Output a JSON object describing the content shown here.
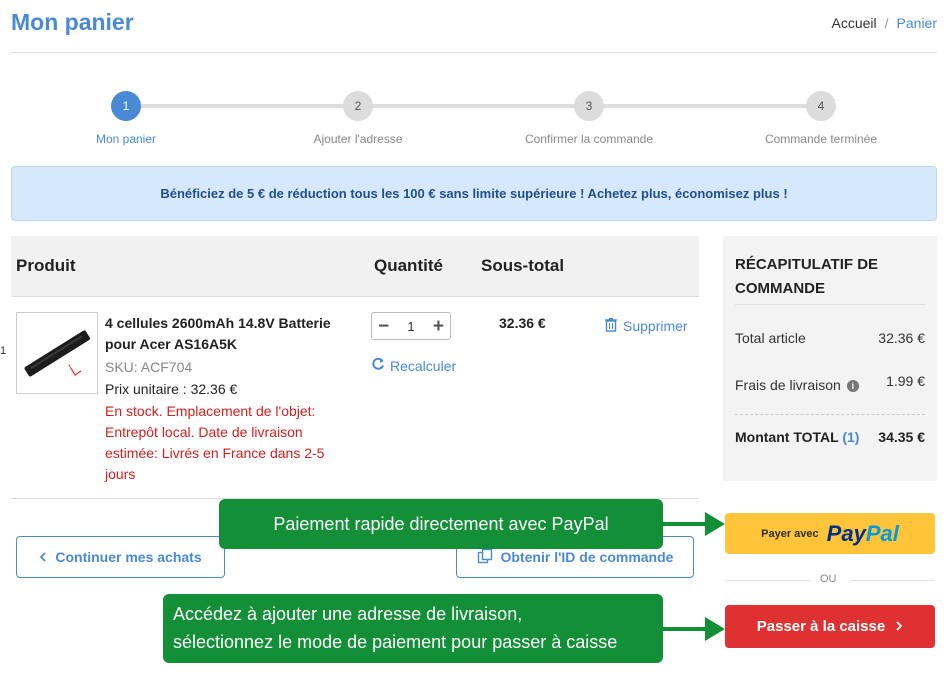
{
  "header": {
    "title": "Mon panier",
    "breadcrumb": [
      "Accueil",
      "/",
      "Panier"
    ]
  },
  "steps": [
    {
      "num": "1",
      "label": "Mon panier"
    },
    {
      "num": "2",
      "label": "Ajouter l'adresse"
    },
    {
      "num": "3",
      "label": "Confirmer la commande"
    },
    {
      "num": "4",
      "label": "Commande terminée"
    }
  ],
  "promo": "Bénéficiez de 5 € de réduction tous les 100 € sans limite supérieure ! Achetez plus, économisez plus !",
  "table": {
    "col_product": "Produit",
    "col_qty": "Quantité",
    "col_subtotal": "Sous-total"
  },
  "item": {
    "name": "4 cellules 2600mAh 14.8V Batterie pour Acer AS16A5K",
    "sku": "SKU: ACF704",
    "unit_price": "Prix unitaire : 32.36 €",
    "stock": "En stock. Emplacement de l'objet: Entrepôt local. Date de livraison estimée: Livrés en France dans 2-5 jours",
    "quantity": "1",
    "recalc": "Recalculer",
    "subtotal": "32.36 €",
    "delete": "Supprimer",
    "stray_char": "1"
  },
  "summary": {
    "title": "RÉCAPITULATIF DE COMMANDE",
    "items_label": "Total article",
    "items_value": "32.36 €",
    "shipping_label": "Frais de livraison",
    "shipping_value": "1.99 €",
    "total_label": "Montant TOTAL",
    "total_count": "(1)",
    "total_value": "34.35 €"
  },
  "buttons": {
    "continue": "Continuer mes achats",
    "get_id": "Obtenir l'ID de commande",
    "paypal_small": "Payer avec",
    "paypal_pay": "Pay",
    "paypal_pal": "Pal",
    "or": "OU",
    "checkout": "Passer à la caisse"
  },
  "callouts": {
    "paypal": "Paiement rapide directement avec PayPal",
    "checkout_line1": "Accédez à ajouter une adresse de livraison,",
    "checkout_line2": "sélectionnez le mode de paiement pour passer à caisse"
  },
  "colors": {
    "brand": "#4a8ad4",
    "promo_bg": "#d6e8fb",
    "stock_text": "#d32020",
    "checkout_bg": "#df3131",
    "paypal_bg": "#ffc439",
    "callout_bg": "#128f37"
  }
}
